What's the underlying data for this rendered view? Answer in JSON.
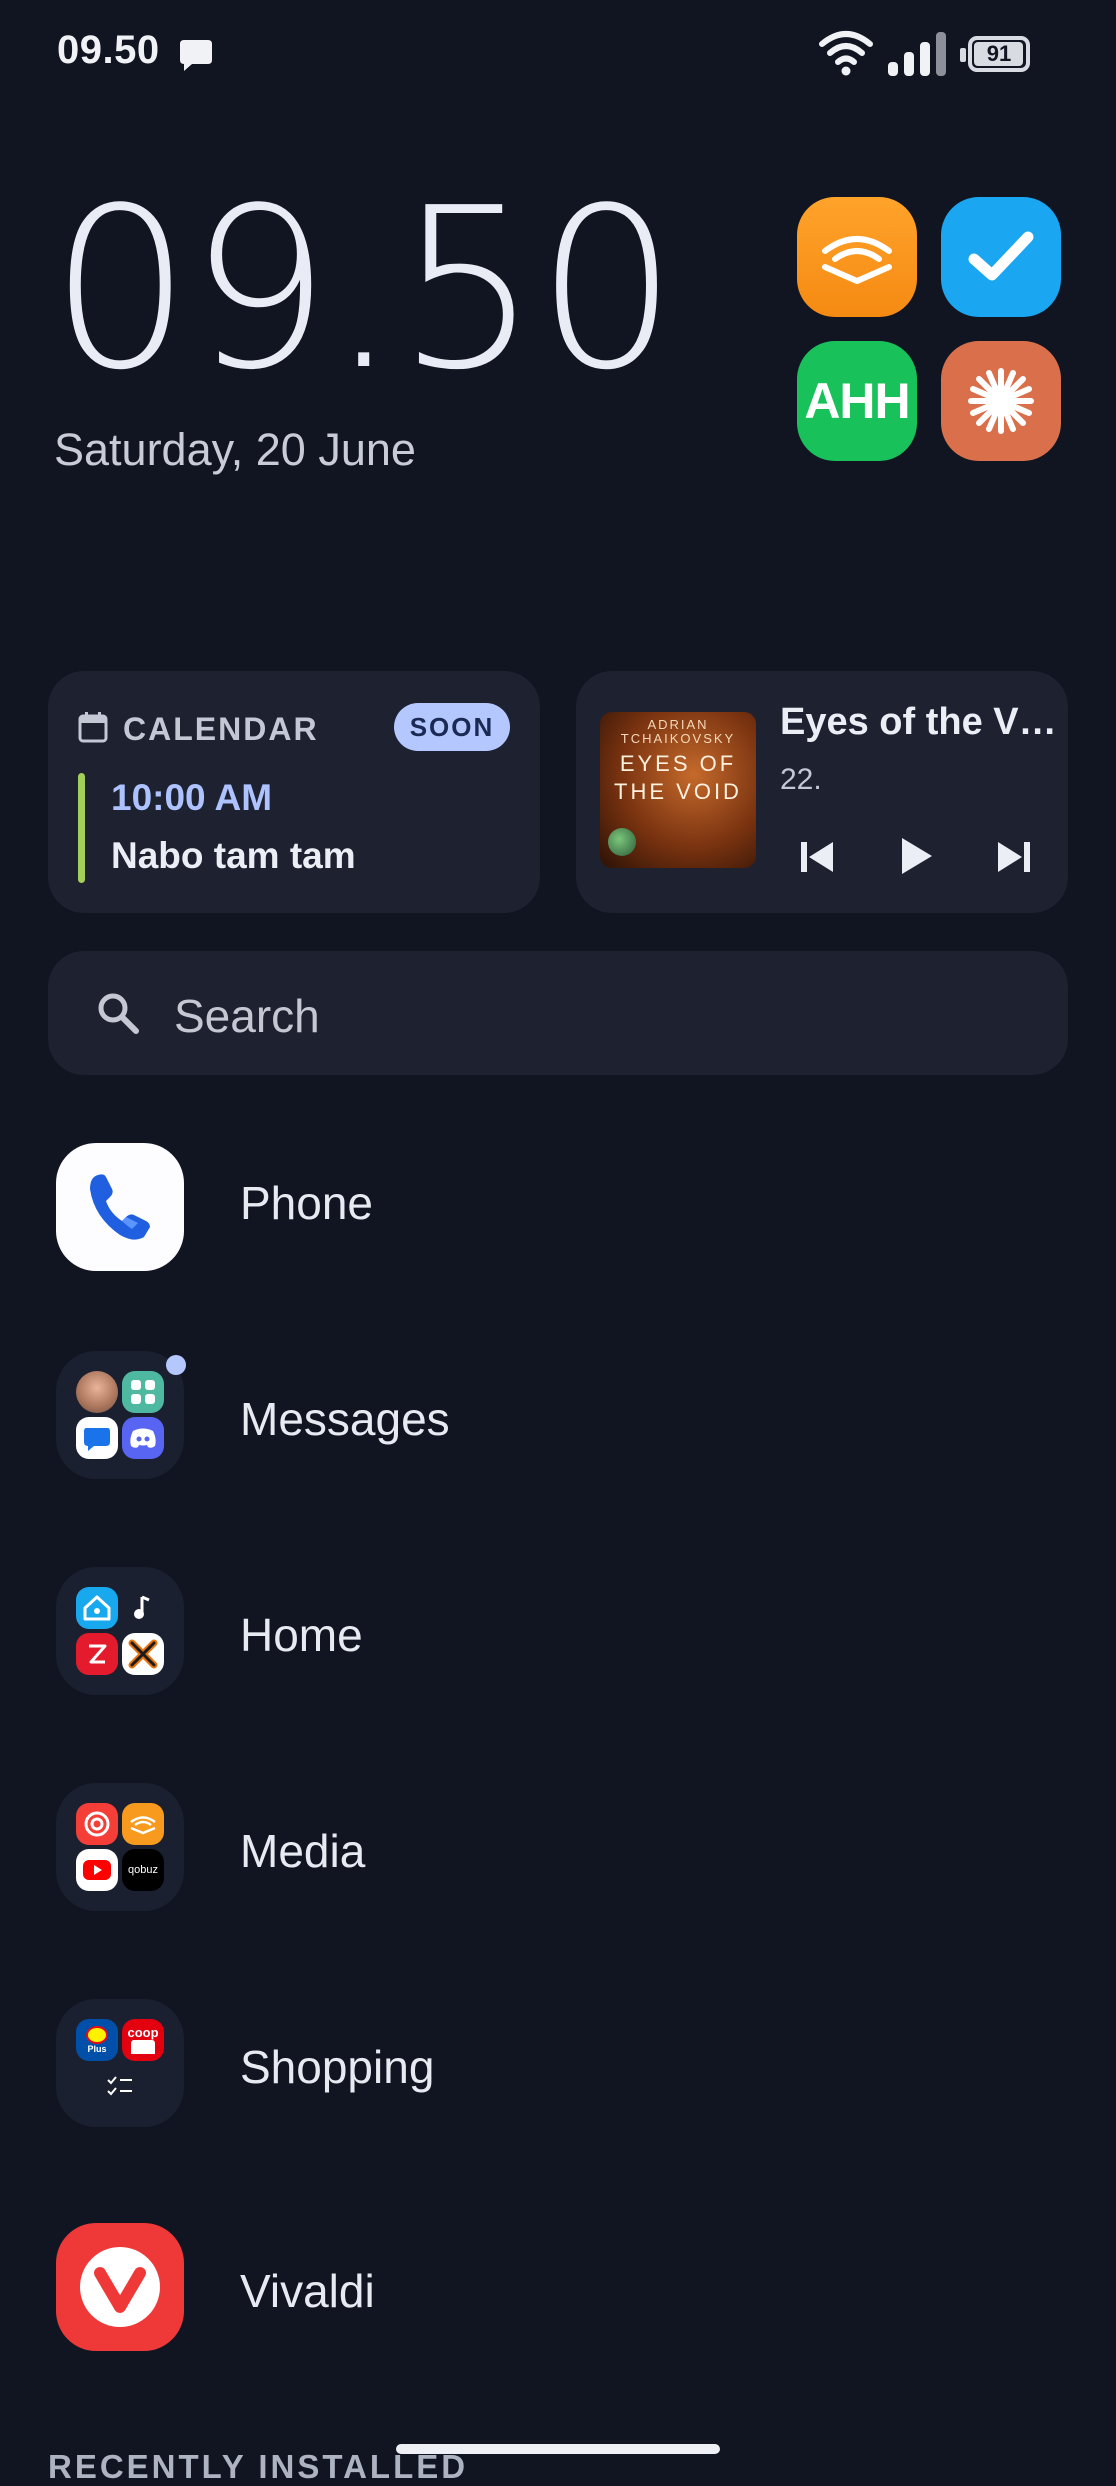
{
  "status_bar": {
    "time": "09.50",
    "battery_level": "91",
    "icons": [
      "chat-notification-icon",
      "wifi-icon",
      "signal-icon",
      "battery-icon"
    ]
  },
  "clock": {
    "time": "09.50",
    "date": "Saturday, 20 June"
  },
  "quick_apps": [
    {
      "name": "audible",
      "label": ""
    },
    {
      "name": "tasks",
      "label": ""
    },
    {
      "name": "ahh",
      "label": "AHH"
    },
    {
      "name": "claude",
      "label": ""
    }
  ],
  "calendar_widget": {
    "title": "CALENDAR",
    "badge": "SOON",
    "event_time": "10:00 AM",
    "event_name": "Nabo tam tam",
    "accent_color": "#a3cf58"
  },
  "media_widget": {
    "cover_author": "ADRIAN TCHAIKOVSKY",
    "cover_title": "EYES OF THE VOID",
    "title": "Eyes of the V…",
    "subtitle": "22."
  },
  "search": {
    "placeholder": "Search"
  },
  "app_list": [
    {
      "label": "Phone"
    },
    {
      "label": "Messages"
    },
    {
      "label": "Home"
    },
    {
      "label": "Media"
    },
    {
      "label": "Shopping"
    },
    {
      "label": "Vivaldi"
    }
  ],
  "folder_minis": {
    "shopping_lidl": "Plus",
    "shopping_coop": "coop",
    "media_qobuz": "qobuz"
  },
  "section_header": "RECENTLY INSTALLED",
  "colors": {
    "background": "#111522",
    "card": "#1d2130",
    "accent": "#b4c8ff"
  }
}
